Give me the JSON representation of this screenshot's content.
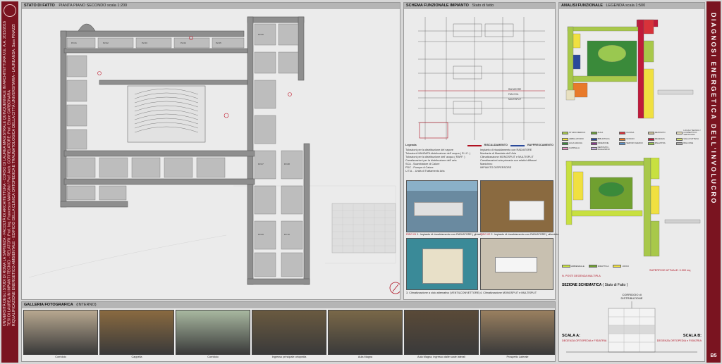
{
  "left_strip": {
    "text_lines": [
      "UNIVERSITÀ DEGLI STUDI DI ROMA LA SAPIENZA - FACOLTÀ DI ARCHITETTURA - CORSO DI LAUREA MAGISTRALE QUINQUENNALE IN ARCHITETTURA U.E. A.A. 2015/2016",
      "TESI DI LAUREA IN IMPIANTI TECNICI - RELATORI: Prof. Ing. Francesco MANCINI / Prof. Arch. CORRELATORE: Prof. Ettore CARBONARA",
      "RIQUALIFICAZIONE ENERGETICO-AMBIENTALE - EDIFICIO DELLA CLINICA ORTOPEDICA E TRAUMATOLOGICA DELLA CITTÀ UNIVERSITARIA - LAUREANDA: Sara PINAZZI"
    ]
  },
  "right_strip": {
    "title": "DIAGNOSI ENERGETICA DELL'INVOLUCRO",
    "code": "B5"
  },
  "panels": {
    "stato": {
      "title": "STATO DI FATTO",
      "subtitle": "PIANTA PIANO SECONDO scala 1:200"
    },
    "schema": {
      "title": "SCHEMA FUNZIONALE IMPIANTO",
      "subtitle": "Stato di fatto"
    },
    "analisi": {
      "title": "ANALISI FUNZIONALE",
      "subtitle": "LEGENDA scala 1:500"
    },
    "galleria": {
      "title": "GALLERIA FOTOGRAFICA",
      "subtitle": "(INTERNO)"
    }
  },
  "schema_legend": {
    "title": "Legenda",
    "heads": [
      "RISCALDAMENTO",
      "RAFFRESCAMENTO"
    ],
    "left_items": [
      "Tubazioni per la distribuzione del vapore",
      "Tubazioni MANDATA distribuzione dell' acqua ( R.I.C. )",
      "Tubazioni per la distribuzione dell' acqua ( RAFF. )",
      "Canalizzazioni per la distribuzione dell' aria",
      "SCA - Scambiatore di Calore",
      "PDC - Pompa di Calore",
      "U.T.A. - Unità di Trattamento Aria"
    ],
    "right_items": [
      "Impianto di riscaldamento con RADIATORE",
      "Montante di Mandata dell' Aria",
      "Climatizzazione MONOSPLIT e MULTISPLIT",
      "Canalizzazioni aria primaria con relativi diffusori",
      "Manichino",
      "IMPIANTO DISPERSORE"
    ],
    "labels": [
      "RADIATORE",
      "FAN COIL",
      "MULTISPLIT"
    ]
  },
  "schema_photos": {
    "caption_1": "1. Impianto di riscaldamento con RADIATORE ( ghisa )",
    "caption_2": "2. Impianto di riscaldamento con RADIATORE ( alluminio )",
    "caption_3": "3. Climatizzazione a ciclo alternativo (VENTILCONVETTORE)",
    "caption_4": "4. Climatizzazione MONOSPLIT e MULTISPLIT",
    "code_1": "RISC.01",
    "code_2": "RISC.02"
  },
  "analisi_legend": {
    "items": [
      {
        "label": "STUDIO MEDICO",
        "color": "#a8c84a"
      },
      {
        "label": "AULA",
        "color": "#6b9a3a"
      },
      {
        "label": "CUCINA",
        "color": "#d8323a"
      },
      {
        "label": "DEPOSITO",
        "color": "#c8c09a"
      },
      {
        "label": "LOCALI TECNICI / CONNETTIVO VERTICALE",
        "color": "#e8e0c0"
      },
      {
        "label": "AMBULATORIO",
        "color": "#f0e040"
      },
      {
        "label": "BIBLIOTECA",
        "color": "#2a4a9a"
      },
      {
        "label": "UFFICIO",
        "color": "#e87a2a"
      },
      {
        "label": "DEGENZA",
        "color": "#c01a3a"
      },
      {
        "label": "SALA D'ATTESA",
        "color": "#d4e070"
      },
      {
        "label": "AULA MAGNA",
        "color": "#3a8a3a"
      },
      {
        "label": "DIREZIONE",
        "color": "#8a3a8a"
      },
      {
        "label": "SERVIZI IGIENICI",
        "color": "#5a90c8"
      },
      {
        "label": "PALESTRA",
        "color": "#9ac850"
      },
      {
        "label": "BALCONE",
        "color": "#b0b0b0"
      },
      {
        "label": "CAPPELLA",
        "color": "#e890c0"
      },
      {
        "label": "DEPOSITO - MAGAZZINO",
        "color": "#c8b0e0"
      }
    ],
    "lower_items": [
      {
        "label": "ABBIENDALE",
        "color": "#c8e040"
      },
      {
        "label": "DIDATTICA",
        "color": "#70a030"
      },
      {
        "label": "UFFICI",
        "color": "#f0e040"
      }
    ],
    "note": "N. POSTI DEGENZA MULTIPLA",
    "surface_note": "SUPERFICIE ATTUALE: 3.900 mq",
    "section_title": "SEZIONE SCHEMATICA",
    "section_sub": "( Stato di Fatto )",
    "corridor": "CORRIDOIO di DISTRIBUZIONE",
    "scala_a": "SCALA A:",
    "scala_a_sub": "DEGENZA ORTOPEDIA e FISIATRIA",
    "scala_b": "SCALA B:",
    "scala_b_sub": "DEGENZA ORTOPEDIA e FISIATRIA"
  },
  "gallery": [
    {
      "caption": "Corridoio",
      "bg": "#b8a890"
    },
    {
      "caption": "Cappella",
      "bg": "#8a6a40"
    },
    {
      "caption": "Corridoio",
      "bg": "#a8b8a0"
    },
    {
      "caption": "Ingresso principale ortopedia",
      "bg": "#6a5a40"
    },
    {
      "caption": "Aula Magna",
      "bg": "#7a6848"
    },
    {
      "caption": "Aula Magna, ingresso dalle scale laterali",
      "bg": "#5a4a38"
    },
    {
      "caption": "Prospetto Laterale",
      "bg": "#9a8060"
    }
  ],
  "stato_labels": {
    "north": "N",
    "room_codes": [
      "P2.01",
      "P2.02",
      "P2.03",
      "P2.04",
      "P2.05",
      "P2.06",
      "P2.07",
      "P2.08",
      "P2.09",
      "P2.10"
    ]
  }
}
